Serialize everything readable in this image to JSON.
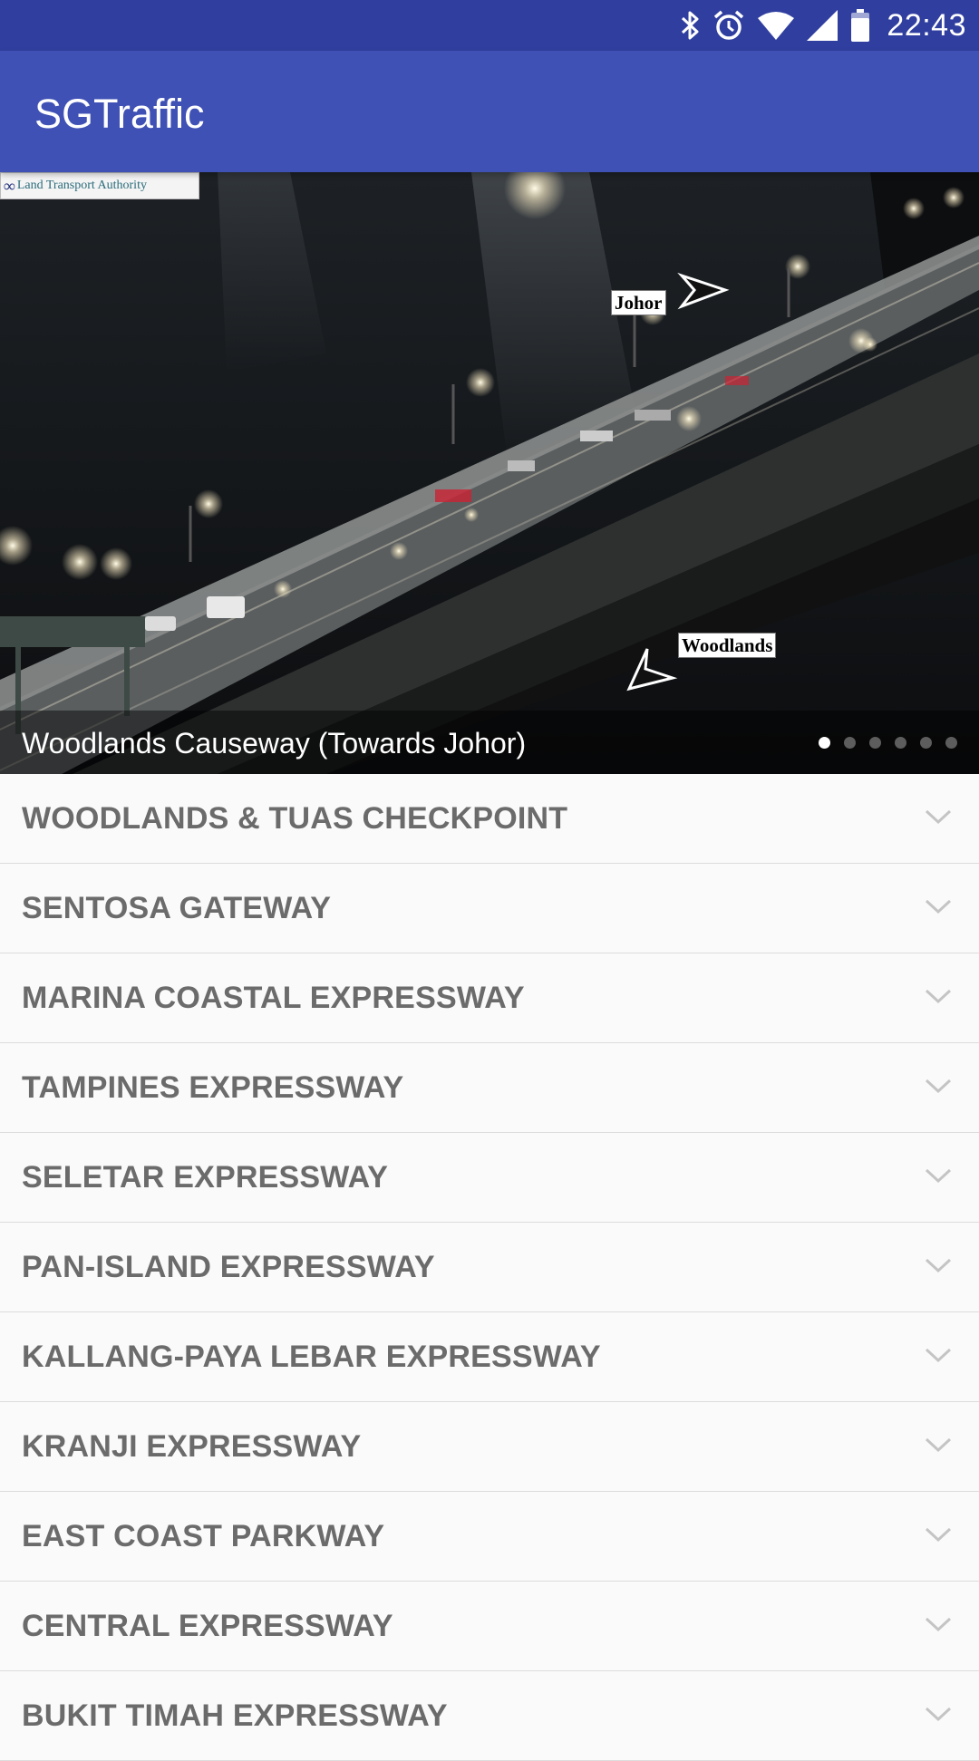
{
  "status_bar": {
    "time": "22:43",
    "icons": [
      "bluetooth-icon",
      "alarm-icon",
      "wifi-icon",
      "cell-signal-icon",
      "battery-icon"
    ]
  },
  "app_bar": {
    "title": "SGTraffic"
  },
  "camera": {
    "logo_text": "Land Transport Authority",
    "sign_johor": "Johor",
    "sign_woodlands": "Woodlands",
    "caption": "Woodlands Causeway (Towards Johor)",
    "page_count": 6,
    "active_page": 1
  },
  "list": {
    "items": [
      {
        "label": "WOODLANDS & TUAS CHECKPOINT"
      },
      {
        "label": "SENTOSA GATEWAY"
      },
      {
        "label": "MARINA COASTAL EXPRESSWAY"
      },
      {
        "label": "TAMPINES EXPRESSWAY"
      },
      {
        "label": "SELETAR EXPRESSWAY"
      },
      {
        "label": "PAN-ISLAND EXPRESSWAY"
      },
      {
        "label": "KALLANG-PAYA LEBAR EXPRESSWAY"
      },
      {
        "label": "KRANJI EXPRESSWAY"
      },
      {
        "label": "EAST COAST PARKWAY"
      },
      {
        "label": "CENTRAL EXPRESSWAY"
      },
      {
        "label": "BUKIT TIMAH EXPRESSWAY"
      }
    ]
  },
  "colors": {
    "status_bar": "#303f9f",
    "app_bar": "#3f51b5",
    "list_text": "#6b6b6b",
    "divider": "#dcdcdc"
  }
}
